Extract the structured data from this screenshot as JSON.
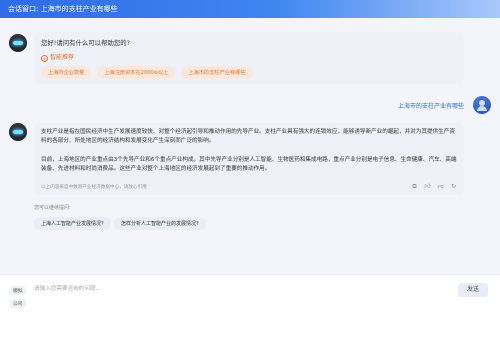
{
  "header": {
    "label": "会话窗口:",
    "title": "上海市的支柱产业有哪些"
  },
  "greeting": {
    "text": "您好!请问有什么可以帮助您的?",
    "recommend_label": "智能推荐",
    "chips": [
      "上海市企业数量",
      "上海注册资本在2000w以上",
      "上海市的支柱产业有哪些"
    ]
  },
  "user_message": "上海市的支柱产业有哪些",
  "answer": {
    "paragraph1": "支柱产业是指在国民经济中生产发展速度较快、对整个经济起引导和推动作用的先导产业。支柱产业具有强大的连锁效应，能够诱导新产业的崛起，并对为其提供生产资料的各部分、所处地区的经济结构和发展变化产生深刻而广泛的影响。",
    "paragraph2": "目前，上海地区的产业重点由3个先导产业和6个重点产业构成，其中先导产业分别是人工智能、生物医药和集成电路，重点产业分别是电子信息、生命健康、汽车、高端装备、先进材料和时尚消费品。这些产业对整个上海地区的经济发展起到了重要的推动作用。",
    "source": "以上内容来自中数新产业经济数据中心，请放心引用"
  },
  "followups": {
    "label": "您可以继续提问:",
    "items": [
      "上海人工智能产业发展情况?",
      "怎样分析人工智能产业的发展情况?"
    ]
  },
  "input": {
    "tags": [
      "模拟",
      "公司"
    ],
    "placeholder": "请输入您需要咨询的问题...",
    "send_label": "发送"
  }
}
